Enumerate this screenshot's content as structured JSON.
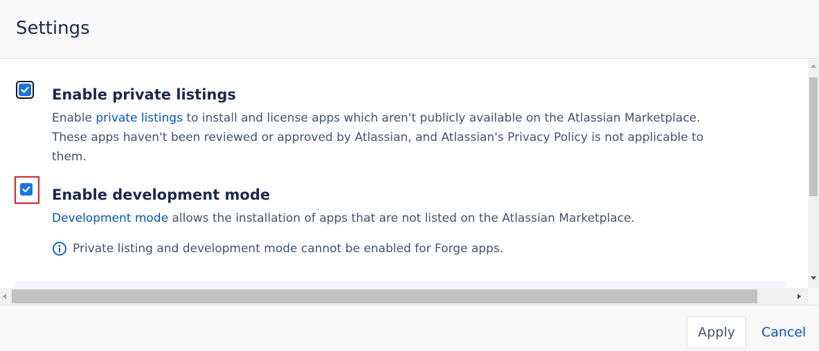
{
  "header": {
    "title": "Settings"
  },
  "settings": [
    {
      "label": "Enable private listings",
      "checked": true,
      "desc_prefix": "Enable ",
      "link_text": "private listings",
      "desc_suffix": " to install and license apps which aren't publicly available on the Atlassian Marketplace. These apps haven't been reviewed or approved by Atlassian, and Atlassian's Privacy Policy is not applicable to them."
    },
    {
      "label": "Enable development mode",
      "checked": true,
      "desc_prefix": "",
      "link_text": "Development mode",
      "desc_suffix": " allows the installation of apps that are not listed on the Atlassian Marketplace."
    }
  ],
  "info": {
    "icon": "info-icon",
    "text": "Private listing and development mode cannot be enabled for Forge apps."
  },
  "footer": {
    "apply_label": "Apply",
    "cancel_label": "Cancel"
  },
  "colors": {
    "accent": "#0052cc",
    "checkbox": "#1a73e8",
    "highlight": "#e11d2b",
    "heading": "#172b4d",
    "text": "#42526e"
  }
}
